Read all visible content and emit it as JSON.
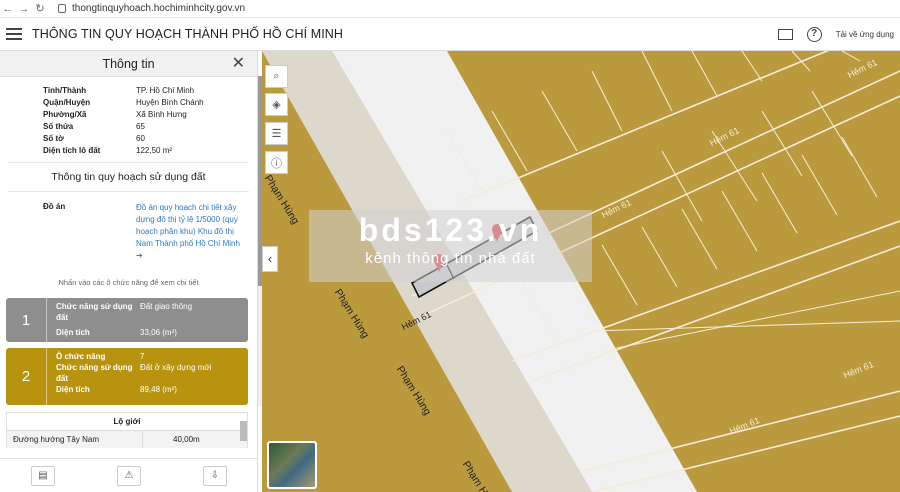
{
  "browser": {
    "url": "thongtinquyhoach.hochiminhcity.gov.vn"
  },
  "header": {
    "title": "THÔNG TIN QUY HOẠCH THÀNH PHỐ HỒ CHÍ MINH",
    "app_link": "Tải về ứng dụng",
    "help": "?"
  },
  "panel": {
    "title": "Thông tin",
    "rows": [
      {
        "k": "Tỉnh/Thành",
        "v": "TP. Hồ Chí Minh"
      },
      {
        "k": "Quận/Huyện",
        "v": "Huyện Bình Chánh"
      },
      {
        "k": "Phường/Xã",
        "v": "Xã Bình Hưng"
      },
      {
        "k": "Số thửa",
        "v": "65"
      },
      {
        "k": "Số tờ",
        "v": "60"
      },
      {
        "k": "Diện tích lô đất",
        "v": "122,50 m²"
      }
    ],
    "section_title": "Thông tin quy hoạch sử dụng đất",
    "doan_label": "Đồ án",
    "doan_value": "Đồ án quy hoạch chi tiết xây dựng đô thị tỷ lệ 1/5000 (quy hoạch phân khu) Khu đô thị Nam Thành phố Hồ Chí Minh",
    "hint": "Nhấn vào các ô chức năng để xem chi tiết",
    "card1": {
      "num": "1",
      "k1": "Chức năng sử dụng đất",
      "v1": "Đất giao thông",
      "k2": "Diện tích",
      "v2": "33,06 (m²)"
    },
    "card2": {
      "num": "2",
      "k0": "Ô chức năng",
      "v0": "7",
      "k1": "Chức năng sử dụng đất",
      "v1": "Đất ở xây dựng mới",
      "k2": "Diện tích",
      "v2": "89,48 (m²)"
    },
    "loigioi": {
      "title": "Lộ giới",
      "k": "Đường hướng Tây Nam",
      "v": "40,00m"
    }
  },
  "map": {
    "street_main": "Phạm Hùng",
    "hem": "Hẻm 61",
    "watermark_big": "bds123.vn",
    "watermark_small": "kênh thông tin nhà đất",
    "colors": {
      "land": "#bb9a3e",
      "road": "#f1f1f1",
      "road2": "#ddd8cc"
    }
  }
}
